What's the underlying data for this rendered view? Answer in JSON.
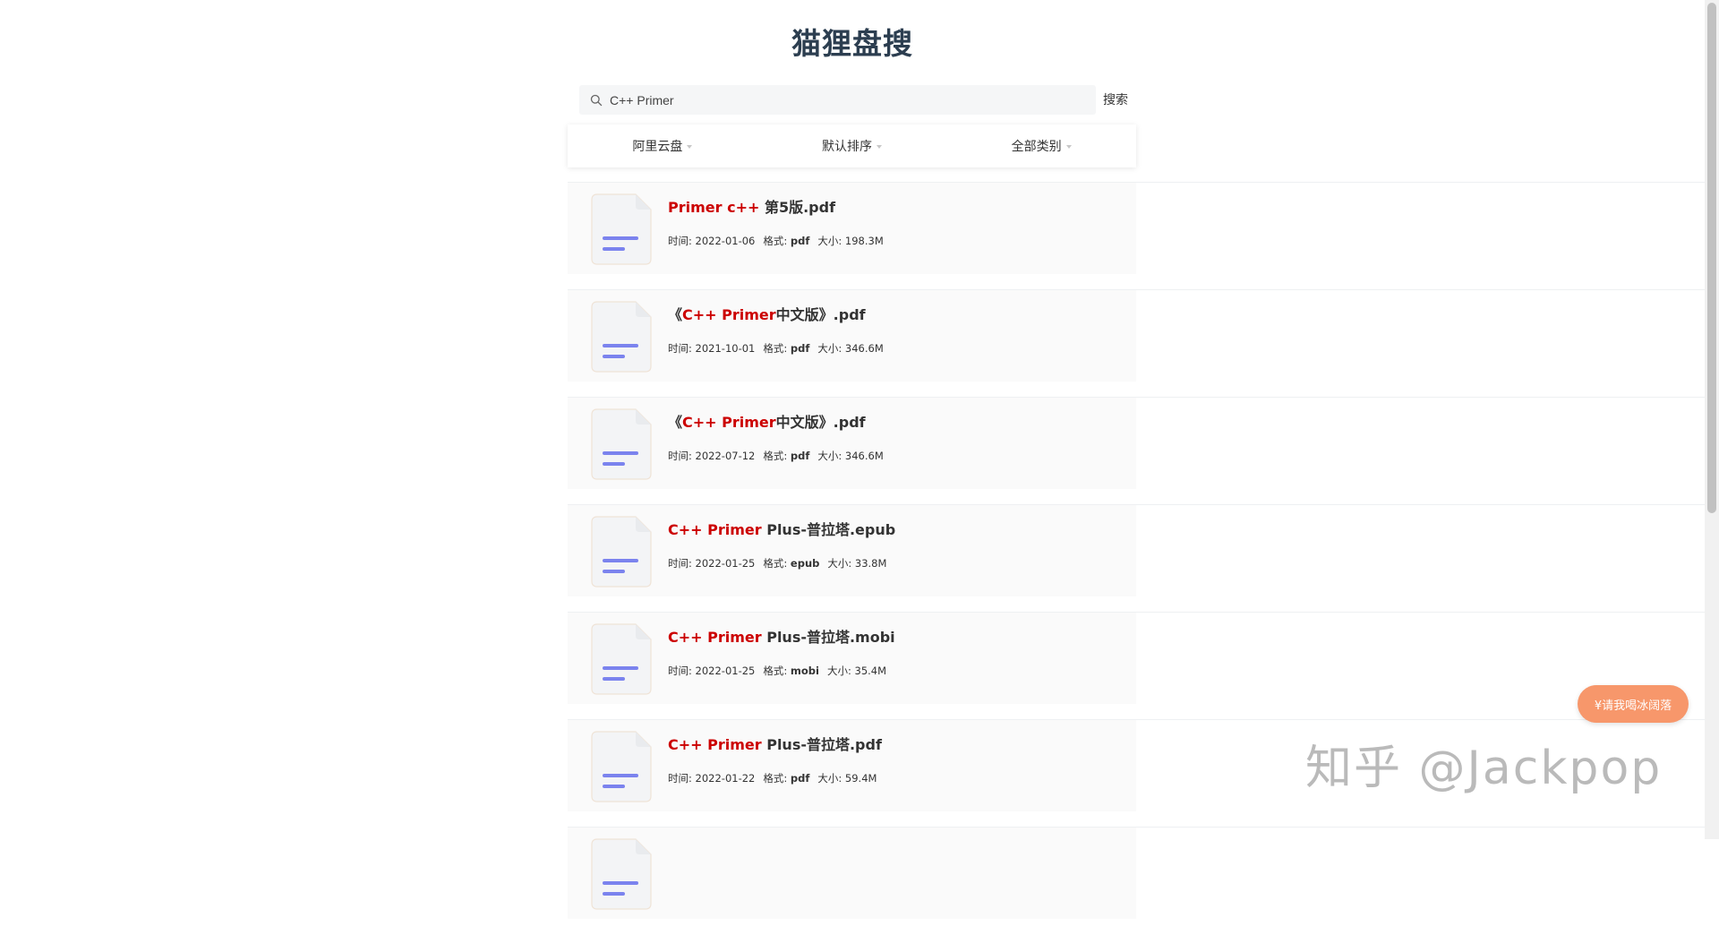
{
  "site": {
    "title": "猫狸盘搜"
  },
  "search": {
    "value": "C++ Primer",
    "button_label": "搜索"
  },
  "filters": [
    {
      "label": "阿里云盘"
    },
    {
      "label": "默认排序"
    },
    {
      "label": "全部类别"
    }
  ],
  "meta_labels": {
    "time": "时间: ",
    "format": "格式: ",
    "size": "大小: "
  },
  "results": [
    {
      "title_hl": "Primer c++",
      "title_rest": " 第5版.pdf",
      "time": "2022-01-06",
      "format": "pdf",
      "size": "198.3M"
    },
    {
      "title_pre": "《",
      "title_hl": "C++ Primer",
      "title_rest": "中文版》.pdf",
      "time": "2021-10-01",
      "format": "pdf",
      "size": "346.6M"
    },
    {
      "title_pre": "《",
      "title_hl": "C++ Primer",
      "title_rest": "中文版》.pdf",
      "time": "2022-07-12",
      "format": "pdf",
      "size": "346.6M"
    },
    {
      "title_hl": "C++ Primer",
      "title_rest": " Plus-普拉塔.epub",
      "time": "2022-01-25",
      "format": "epub",
      "size": "33.8M"
    },
    {
      "title_hl": "C++ Primer",
      "title_rest": " Plus-普拉塔.mobi",
      "time": "2022-01-25",
      "format": "mobi",
      "size": "35.4M"
    },
    {
      "title_hl": "C++ Primer",
      "title_rest": " Plus-普拉塔.pdf",
      "time": "2022-01-22",
      "format": "pdf",
      "size": "59.4M"
    }
  ],
  "donate": {
    "label": "¥请我喝冰阔落"
  },
  "watermark": {
    "text": "知乎 @Jackpop"
  },
  "colors": {
    "highlight": "#cc0000",
    "title": "#2c3e50",
    "donate": "#f7976b",
    "icon_lines": "#7b83ee"
  }
}
